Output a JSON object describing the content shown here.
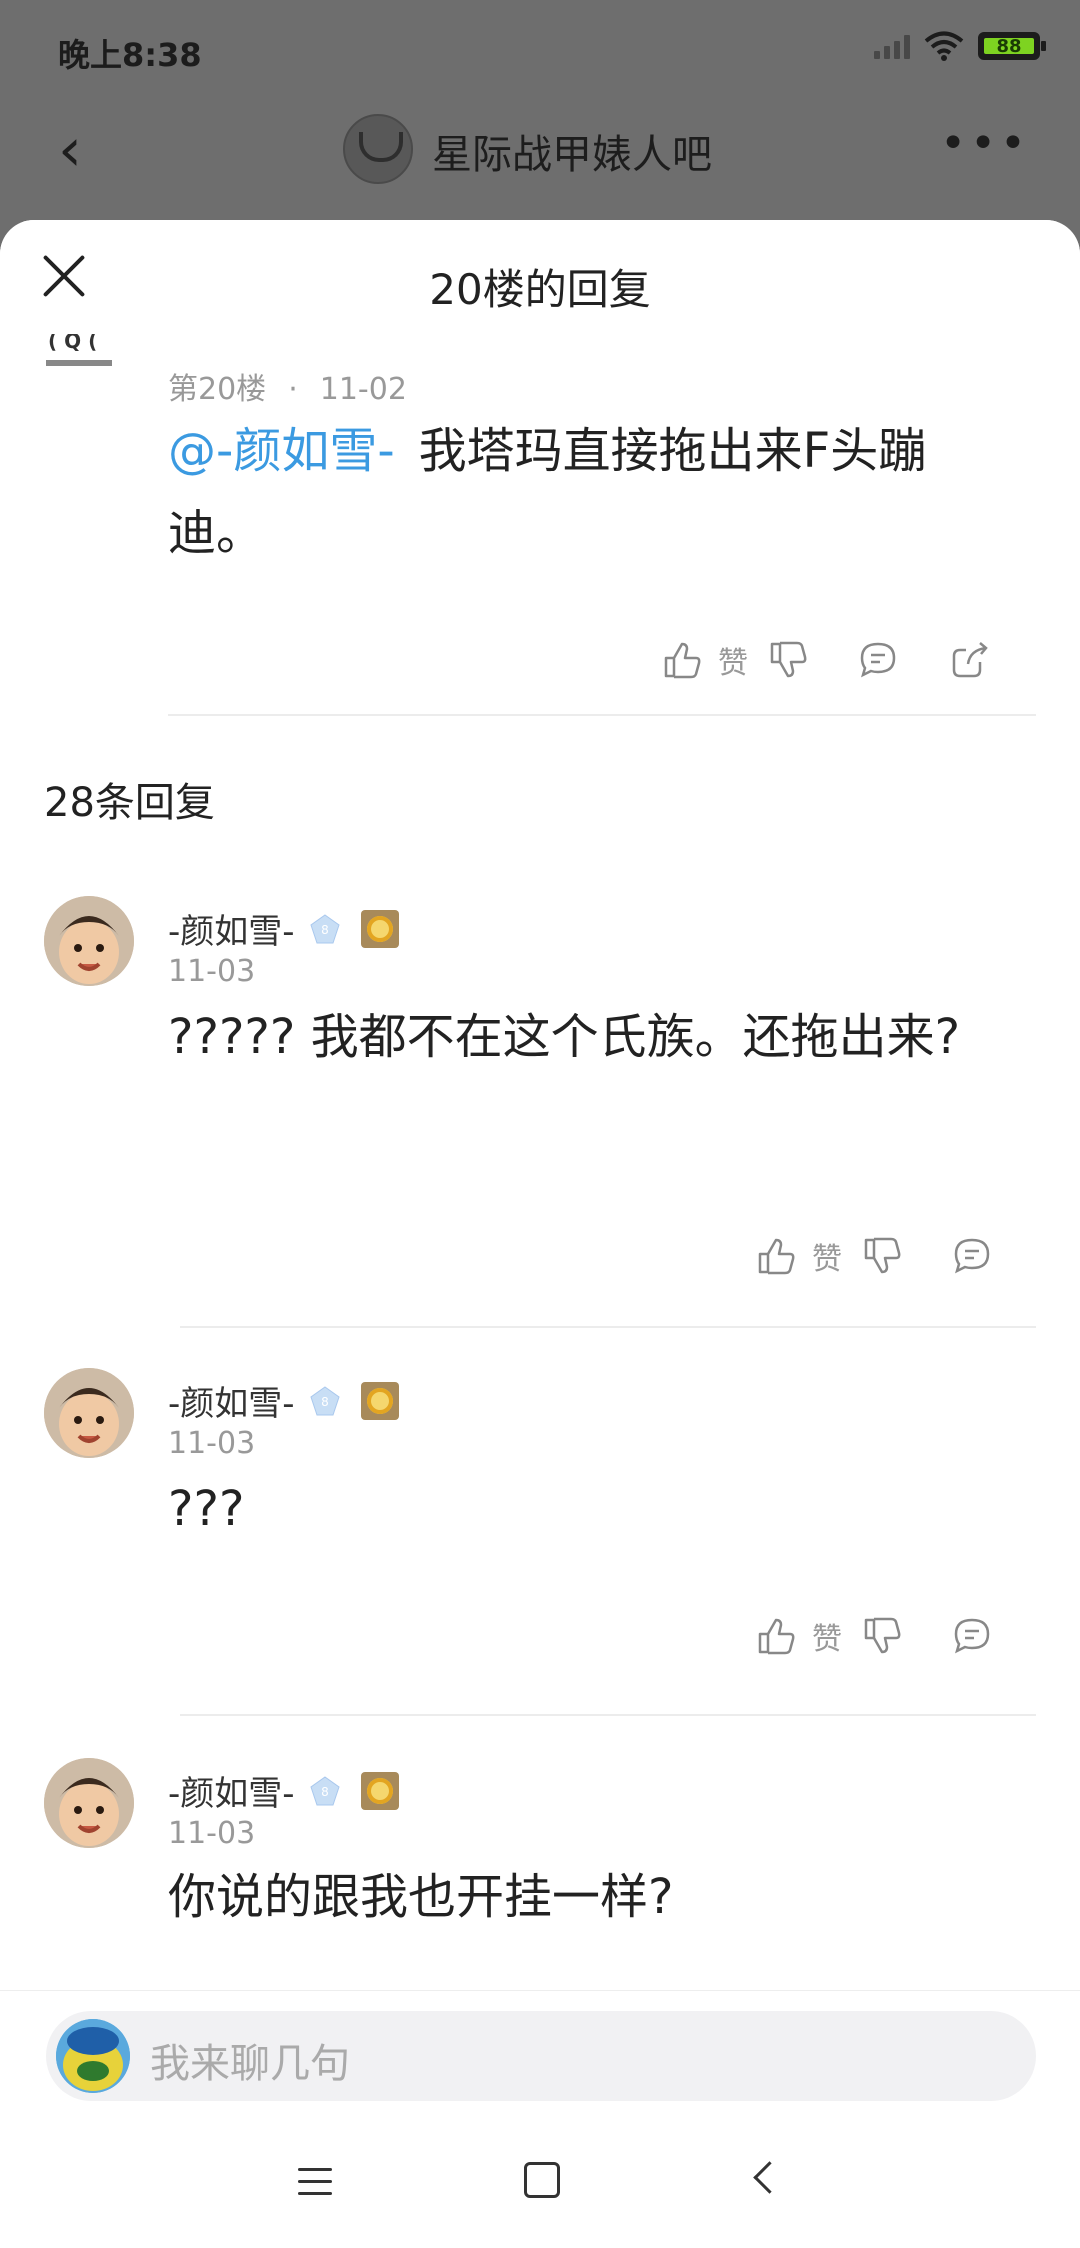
{
  "status_bar": {
    "time": "晚上8:38",
    "battery": "88"
  },
  "background_page": {
    "title": "星际战甲婊人吧",
    "back_icon": "chevron-left-icon",
    "more_icon": "more-dots-icon"
  },
  "sheet": {
    "title": "20楼的回复",
    "close_icon": "close-icon"
  },
  "main_post": {
    "floor": "第20楼",
    "date": "11-02",
    "mention": "@-颜如雪-",
    "text": "我塔玛直接拖出来F头蹦迪。",
    "like_label": "赞"
  },
  "replies_count": "28条回复",
  "replies": [
    {
      "username": "-颜如雪-",
      "level": "8",
      "date": "11-03",
      "text": "????? 我都不在这个氏族。还拖出来?",
      "like_label": "赞"
    },
    {
      "username": "-颜如雪-",
      "level": "8",
      "date": "11-03",
      "text": "???",
      "like_label": "赞"
    },
    {
      "username": "-颜如雪-",
      "level": "8",
      "date": "11-03",
      "text": "你说的跟我也开挂一样?"
    }
  ],
  "input": {
    "placeholder": "我来聊几句"
  },
  "colors": {
    "accent": "#3b9ae1",
    "battery": "#7ed321"
  }
}
